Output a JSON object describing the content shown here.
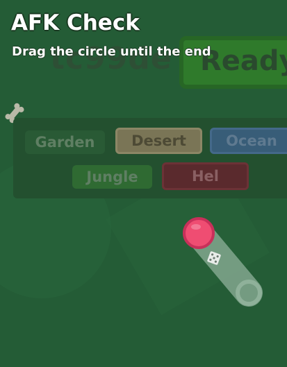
{
  "game_bg": {
    "player_name": "tc99de",
    "ready_label": "Ready"
  },
  "biomes": {
    "garden": "Garden",
    "desert": "Desert",
    "ocean": "Ocean",
    "jungle": "Jungle",
    "hel": "Hel"
  },
  "afk": {
    "title": "AFK Check",
    "instructions": "Drag the circle until the end",
    "progress": 0
  },
  "colors": {
    "handle": "#ef4d72",
    "track": "#8fb19a",
    "background": "#245c36"
  }
}
